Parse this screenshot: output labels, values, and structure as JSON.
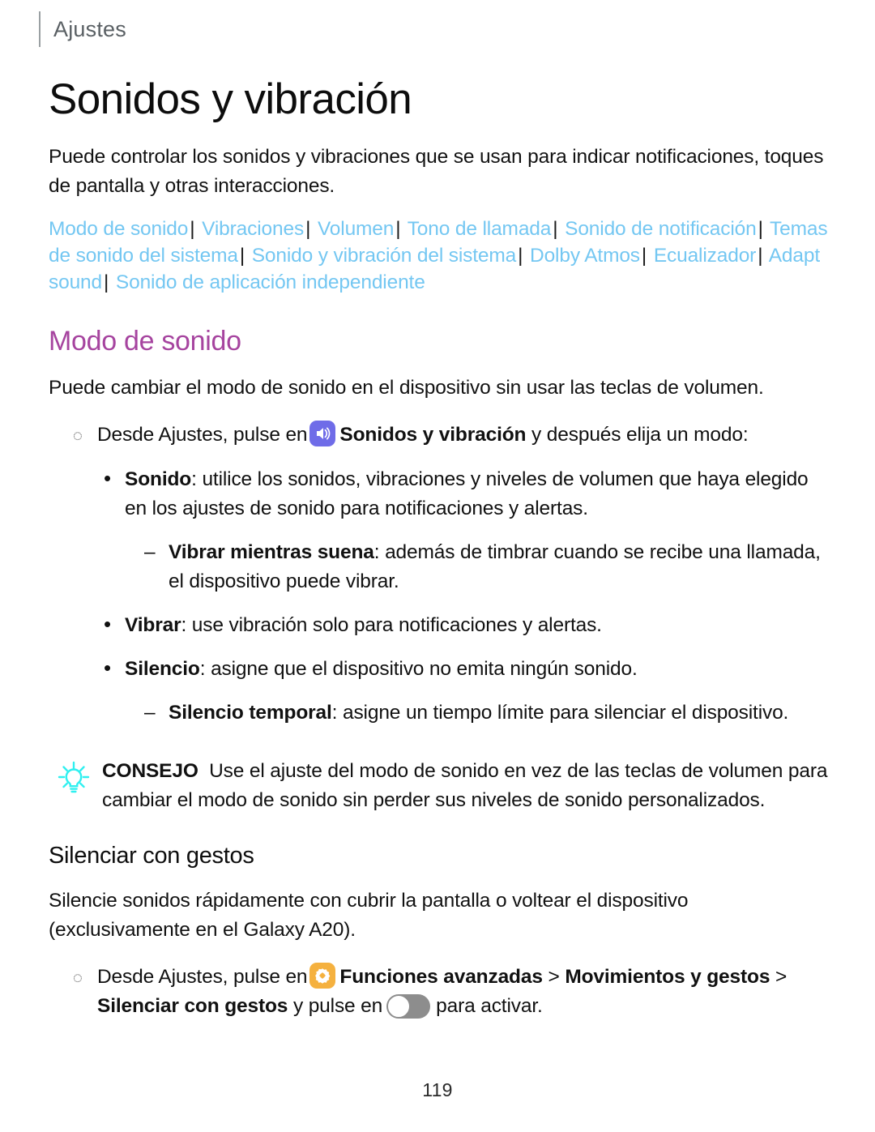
{
  "header": {
    "running_head": "Ajustes",
    "page_title": "Sonidos y vibración"
  },
  "intro": {
    "paragraph": "Puede controlar los sonidos y vibraciones que se usan para indicar notificaciones, toques de pantalla y otras interacciones."
  },
  "link_bar": {
    "separator": "|",
    "links": [
      "Modo de sonido",
      "Vibraciones",
      "Volumen",
      "Tono de llamada",
      "Sonido de notificación",
      "Temas de sonido del sistema",
      "Sonido y vibración del sistema",
      "Dolby Atmos",
      "Ecualizador",
      "Adapt sound",
      "Sonido de aplicación independiente"
    ]
  },
  "section_sound_mode": {
    "heading": "Modo de sonido",
    "paragraph": "Puede cambiar el modo de sonido en el dispositivo sin usar las teclas de volumen.",
    "step": {
      "marker": "◌",
      "lead": "Desde Ajustes, pulse en",
      "icon_name": "sound-and-vibration-icon",
      "target": "Sonidos y vibración",
      "trail": "y después elija un modo:"
    },
    "items": [
      {
        "marker": "•",
        "level": "bullet",
        "term": "Sonido",
        "text": ": utilice los sonidos, vibraciones y niveles de volumen que haya elegido en los ajustes de sonido para notificaciones y alertas."
      },
      {
        "marker": "–",
        "level": "dash",
        "term": "Vibrar mientras suena",
        "text": ": además de timbrar cuando se recibe una llamada, el dispositivo puede vibrar."
      },
      {
        "marker": "•",
        "level": "bullet",
        "term": "Vibrar",
        "text": ": use vibración solo para notificaciones y alertas."
      },
      {
        "marker": "•",
        "level": "bullet",
        "term": "Silencio",
        "text": ": asigne que el dispositivo no emita ningún sonido."
      },
      {
        "marker": "–",
        "level": "dash",
        "term": "Silencio temporal",
        "text": ": asigne un tiempo límite para silenciar el dispositivo."
      }
    ],
    "tip": {
      "icon_name": "lightbulb-icon",
      "label": "CONSEJO",
      "text": "Use el ajuste del modo de sonido en vez de las teclas de volumen para cambiar el modo de sonido sin perder sus niveles de sonido personalizados."
    }
  },
  "section_mute_gestures": {
    "heading": "Silenciar con gestos",
    "paragraph": "Silencie sonidos rápidamente con cubrir la pantalla o voltear el dispositivo (exclusivamente en el Galaxy A20).",
    "step": {
      "marker": "◌",
      "lead": "Desde Ajustes, pulse en",
      "icon_name": "advanced-features-icon",
      "target_1": "Funciones avanzadas",
      "chevron_1": ">",
      "target_2": "Movimientos y gestos",
      "chevron_2": ">",
      "target_3": "Silenciar con gestos",
      "mid": "y pulse en",
      "toggle_state": "off",
      "trail": "para activar."
    }
  },
  "footer": {
    "page_number": "119"
  },
  "colors": {
    "link": "#74c7f2",
    "section_heading": "#a6449f",
    "sound_icon_bg": "#6f6ce8",
    "gear_icon_bg": "#f5b13f",
    "tip_icon": "#2ff0f0",
    "toggle_off_track": "#8d8d8d"
  }
}
